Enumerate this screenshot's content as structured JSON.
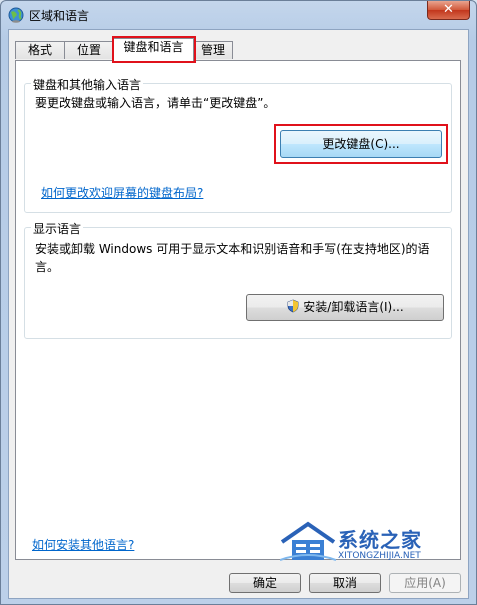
{
  "window": {
    "title": "区域和语言",
    "close_glyph": "✕"
  },
  "tabs": [
    {
      "label": "格式"
    },
    {
      "label": "位置"
    },
    {
      "label": "键盘和语言"
    },
    {
      "label": "管理"
    }
  ],
  "keyboard_group": {
    "title": "键盘和其他输入语言",
    "description": "要更改键盘或输入语言，请单击“更改键盘”。",
    "button": "更改键盘(C)...",
    "link": "如何更改欢迎屏幕的键盘布局?"
  },
  "display_group": {
    "title": "显示语言",
    "description": "安装或卸载 Windows 可用于显示文本和识别语音和手写(在支持地区)的语言。",
    "button": "安装/卸载语言(I)..."
  },
  "bottom_link": "如何安装其他语言?",
  "footer": {
    "ok": "确定",
    "cancel": "取消",
    "apply": "应用(A)"
  },
  "watermark": {
    "main": "系统之家",
    "sub": "XITONGZHIJIA.NET"
  },
  "colors": {
    "highlight": "#e0111b",
    "link": "#0066cc",
    "accent": "#2a62b7"
  }
}
